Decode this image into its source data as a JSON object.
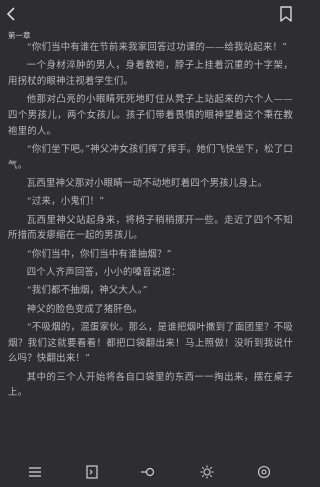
{
  "chapter_title": "第一章",
  "paragraphs": [
    "“你们当中有谁在节前来我家回答过功课的——给我站起来！”",
    "一个身材淬肿的男人，身着教袍，脖子上挂着沉重的十字架，用拐杖的眼神注视着学生们。",
    "他那对凸亮的小眼睛死死地盯住从凳子上站起来的六个人——四个男孩儿，两个女孩儿。孩子们带着畏惧的眼神望着这个秉在教袍里的人。",
    "“你们坐下吧。”神父冲女孩们挥了挥手。她们飞快坐下，松了口气。",
    "瓦西里神父那对小眼睛一动不动地盯着四个男孩儿身上。",
    "“过来，小鬼们！”",
    "瓦西里神父站起身来，将椅子稍稍挪开一些。走近了四个不知所措而发瘳缩在一起的男孩儿。",
    "“你们当中，你们当中有谁抽烟？”",
    "四个人齐声回答，小小的嗓音说道：",
    "“我们都不抽烟，神父大人。”",
    "神父的脸色变成了猪肝色。",
    "“不吸烟的，混蛋家伙。那么，是谁把烟叶撒到了面团里？不吸烟？我们这就要看看！都把口袋翻出来！马上照做！没听到我说什么吗？快翻出来！”",
    "其中的三个人开始将各自口袋里的东西一一掏出来，摆在桌子上。"
  ],
  "icons": {
    "back": "back-arrow-icon",
    "bookmark": "bookmark-icon",
    "menu": "menu-list-icon",
    "progress": "progress-icon",
    "settings": "font-settings-icon",
    "brightness": "brightness-icon",
    "night": "night-mode-icon"
  }
}
